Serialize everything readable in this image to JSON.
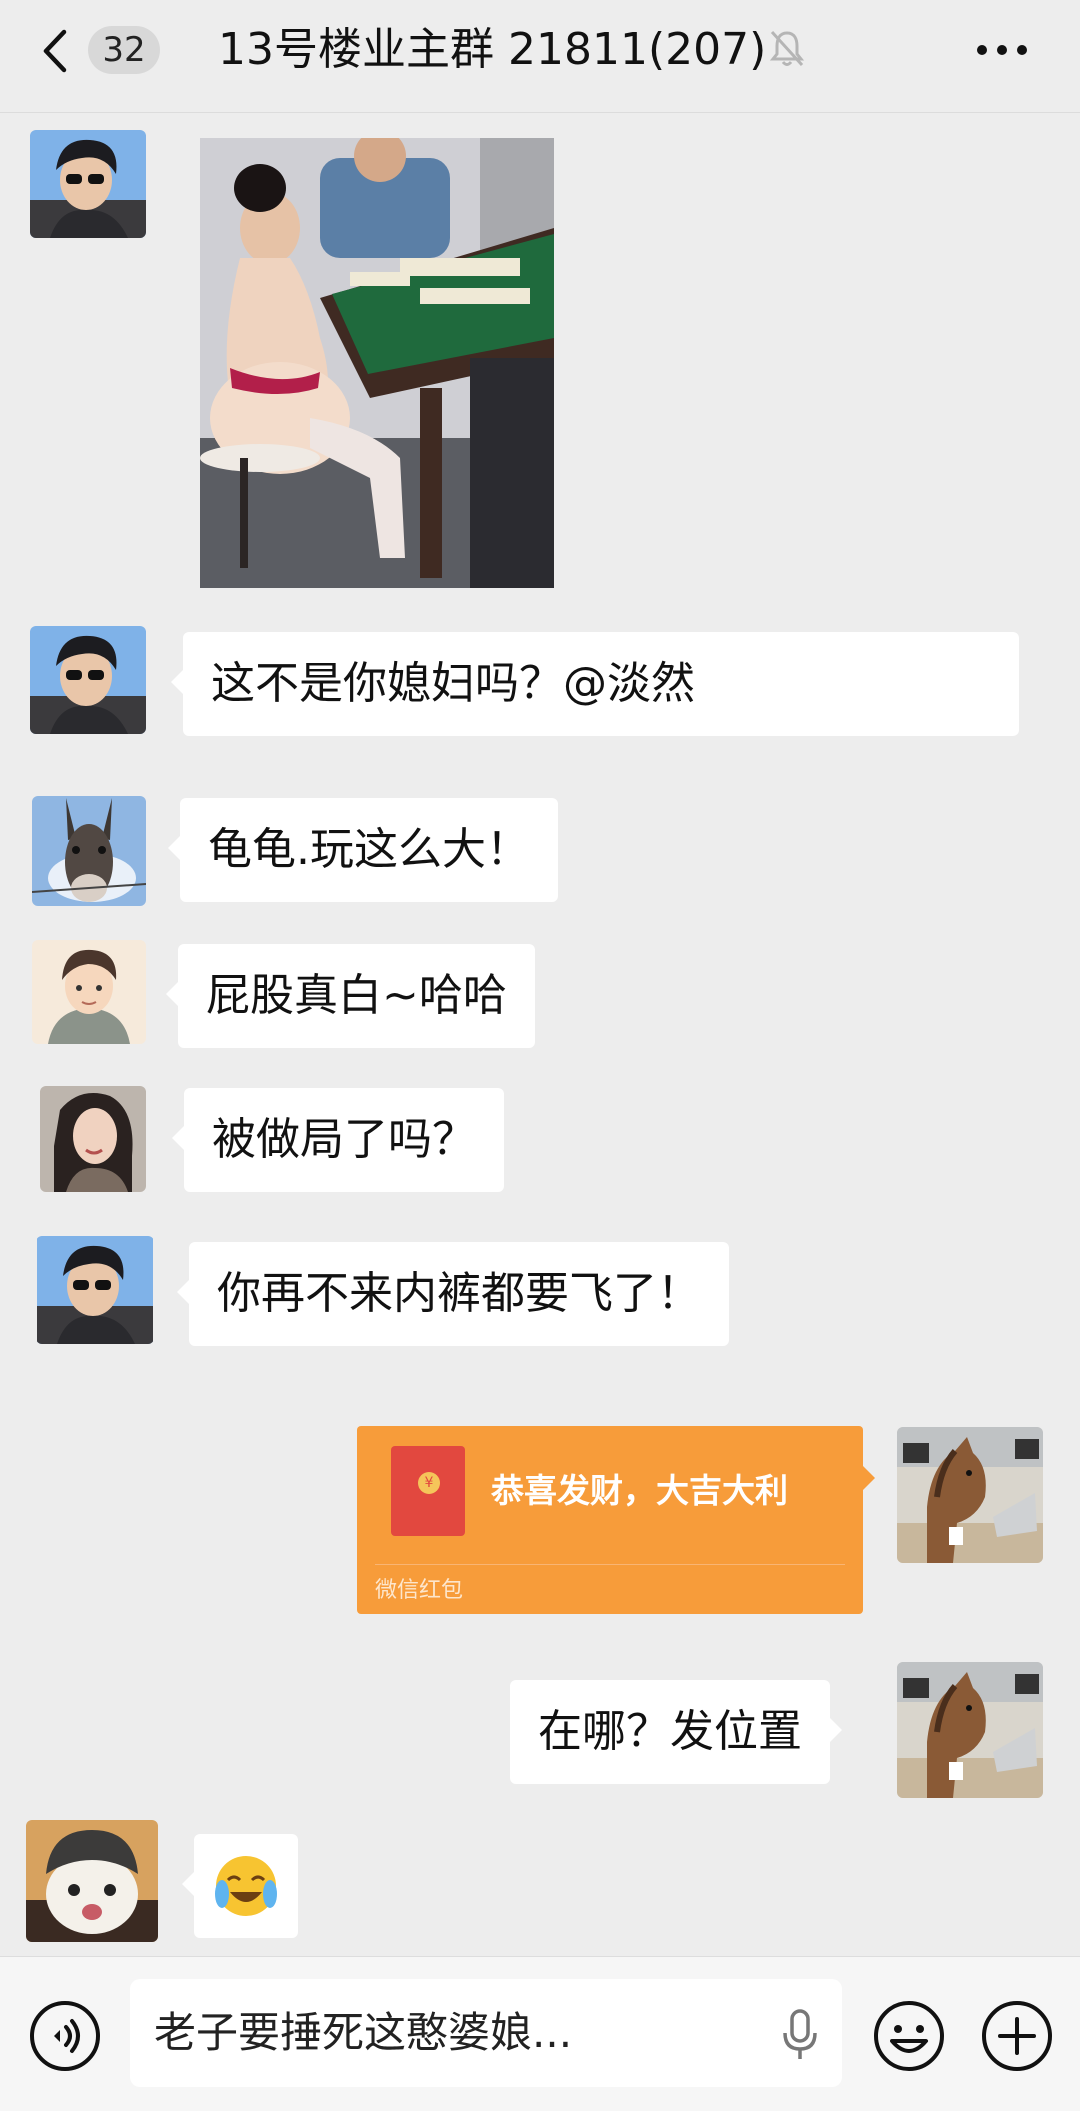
{
  "header": {
    "unread_count": "32",
    "title": "13号楼业主群 21811(207)"
  },
  "messages": [
    {
      "side": "left",
      "type": "image",
      "avatar": "young man in sunglasses"
    },
    {
      "side": "left",
      "type": "text",
      "text": "这不是你媳妇吗？@淡然",
      "avatar": "young man in sunglasses"
    },
    {
      "side": "left",
      "type": "text",
      "text": "龟龟.玩这么大！",
      "avatar": "donkey"
    },
    {
      "side": "left",
      "type": "text",
      "text": "屁股真白~哈哈",
      "avatar": "cartoon boy"
    },
    {
      "side": "left",
      "type": "text",
      "text": "被做局了吗？",
      "avatar": "woman portrait"
    },
    {
      "side": "left",
      "type": "text",
      "text": "你再不来内裤都要飞了！",
      "avatar": "young man in sunglasses"
    },
    {
      "side": "right",
      "type": "red_packet",
      "greeting": "恭喜发财，大吉大利",
      "caption": "微信红包",
      "avatar": "horse at laptop"
    },
    {
      "side": "right",
      "type": "text",
      "text": "在哪？发位置",
      "avatar": "horse at laptop"
    },
    {
      "side": "left",
      "type": "emoji",
      "emoji": "😭",
      "avatar": "cat with helmet"
    }
  ],
  "input_bar": {
    "draft_text": "老子要捶死这憨婆娘..."
  },
  "colors": {
    "background": "#ededed",
    "bubble_in": "#ffffff",
    "red_packet": "#f79c3a"
  }
}
